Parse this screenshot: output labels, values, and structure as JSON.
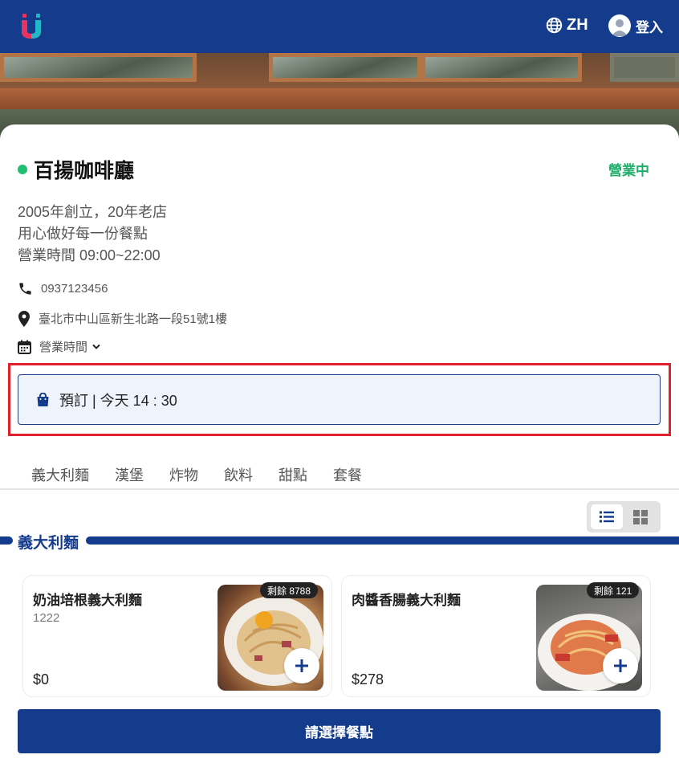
{
  "header": {
    "language_label": "ZH",
    "login_label": "登入",
    "brand_color": "#153b8c"
  },
  "store": {
    "name": "百揚咖啡廳",
    "status": "營業中",
    "status_color": "#1fae6a",
    "description_lines": [
      "2005年創立，20年老店",
      "用心做好每一份餐點",
      "營業時間 09:00~22:00"
    ],
    "phone": "0937123456",
    "address": "臺北市中山區新生北路一段51號1樓",
    "hours_toggle_label": "營業時間"
  },
  "preorder": {
    "label": "預訂 | 今天 14 : 30"
  },
  "category_tabs": [
    "義大利麵",
    "漢堡",
    "炸物",
    "飲料",
    "甜點",
    "套餐"
  ],
  "view_toggle": {
    "selected": "list",
    "options": [
      "list-icon",
      "grid-icon"
    ]
  },
  "section": {
    "title": "義大利麵"
  },
  "items": [
    {
      "name": "奶油培根義大利麵",
      "subtitle": "1222",
      "price": "$0",
      "stock": "剩餘 8788"
    },
    {
      "name": "肉醬香腸義大利麵",
      "subtitle": "",
      "price": "$278",
      "stock": "剩餘 121"
    }
  ],
  "cta": {
    "label": "請選擇餐點"
  }
}
